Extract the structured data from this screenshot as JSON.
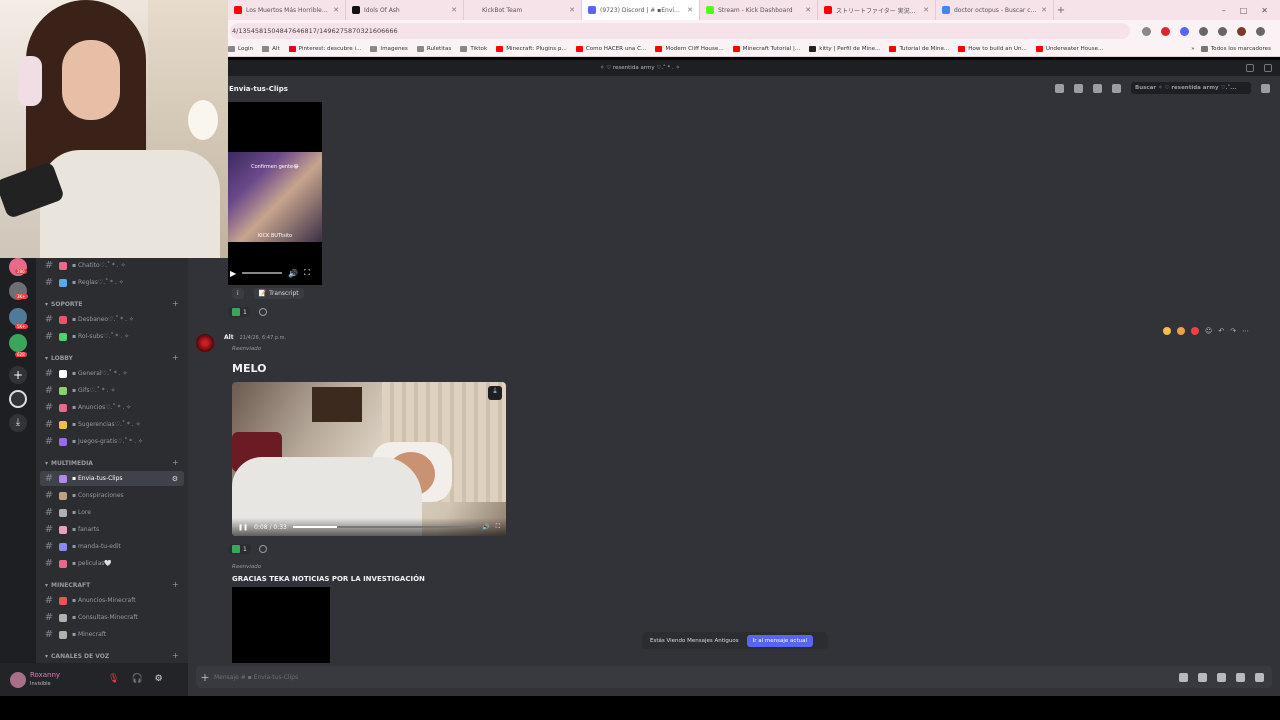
{
  "browser": {
    "tabs": [
      {
        "label": "Los Muertos Más Horribles De...",
        "color": "#ff0000"
      },
      {
        "label": "Idols Of Ash",
        "color": "#111111"
      },
      {
        "label": "KickBot Team",
        "color": "#f6e3ea"
      },
      {
        "label": "(9723) Discord | # ▪Enví...",
        "color": "#5865f2"
      },
      {
        "label": "Stream - Kick Dashboard",
        "color": "#53fc18"
      },
      {
        "label": "ストリートファイター 実況動画 \"LV...",
        "color": "#ff0000"
      },
      {
        "label": "doctor octopus - Buscar con G...",
        "color": "#4285f4"
      }
    ],
    "new_tab": "+",
    "window_controls": [
      "–",
      "□",
      "✕"
    ],
    "url": "4/1354581504847646817/1496275870321606666",
    "bookmarks": [
      {
        "label": "Login",
        "color": "#888888"
      },
      {
        "label": "Alt",
        "color": "#888888"
      },
      {
        "label": "Pinterest: descubre i...",
        "color": "#e60023"
      },
      {
        "label": "Imagenes",
        "color": "#888888"
      },
      {
        "label": "Ruletitas",
        "color": "#888888"
      },
      {
        "label": "Tiktok",
        "color": "#888888"
      },
      {
        "label": "Minecraft: Plugins p...",
        "color": "#ff0000"
      },
      {
        "label": "Como HACER una C...",
        "color": "#ff0000"
      },
      {
        "label": "Modern Cliff House...",
        "color": "#ff0000"
      },
      {
        "label": "Minecraft Tutorial |...",
        "color": "#ff0000"
      },
      {
        "label": "kitty | Perfil de Mine...",
        "color": "#222222"
      },
      {
        "label": "Tutorial de Mine...",
        "color": "#ff0000"
      },
      {
        "label": "How to build an Un...",
        "color": "#ff0000"
      },
      {
        "label": "Underwater House...",
        "color": "#ff0000"
      }
    ],
    "bookmarks_more": "»",
    "all_bookmarks": "Todos los marcadores"
  },
  "discord": {
    "server_title": "✧ ♡ resentida army ♡.˚ * . ✧",
    "channel_header": "Envia-tus-Clips",
    "search_placeholder": "Buscar ✧ ♡ resentida army ♡.˚...",
    "server_badges": [
      "286",
      "3K+",
      "5K+",
      "628"
    ],
    "categories": [
      {
        "label": "SOPORTE",
        "plus": "+"
      },
      {
        "label": "LOBBY",
        "plus": "+"
      },
      {
        "label": "MULTIMEDIA",
        "plus": "+"
      },
      {
        "label": "MINECRAFT",
        "plus": "+"
      },
      {
        "label": "CANALES DE VOZ",
        "plus": "+"
      }
    ],
    "channels": {
      "top": [
        {
          "label": "▪ Chatito♡.˚ * . ✧",
          "color": "#e86a8b"
        },
        {
          "label": "▪ Reglas♡.˚ * . ✧",
          "color": "#5fa8e8"
        }
      ],
      "soporte": [
        {
          "label": "▪ Desbaneo♡.˚ * . ✧",
          "color": "#e8556a"
        },
        {
          "label": "▪ Rol-subs♡.˚ * . ✧",
          "color": "#4fd16b"
        }
      ],
      "lobby": [
        {
          "label": "▪ General♡.˚ * . ✧",
          "color": "#ffffff"
        },
        {
          "label": "▪ Gifs♡.˚ * . ✧",
          "color": "#8bd16b"
        },
        {
          "label": "▪ Anuncios♡.˚ * . ✧",
          "color": "#e86a8b"
        },
        {
          "label": "▪ Sugerencias♡.˚ * . ✧",
          "color": "#f0c04a"
        },
        {
          "label": "▪ Juegos-gratis♡.˚ * . ✧",
          "color": "#9b6ae8"
        }
      ],
      "multimedia": [
        {
          "label": "▪ Envia-tus-Clips",
          "color": "#b08ae8"
        },
        {
          "label": "▪ Conspiraciones",
          "color": "#c0a080"
        },
        {
          "label": "▪ Lore",
          "color": "#b0b0b0"
        },
        {
          "label": "▪ fanarts",
          "color": "#e8a0c0"
        },
        {
          "label": "▪ manda-tu-edit",
          "color": "#8a8ae8"
        },
        {
          "label": "▪ peliculas🤍",
          "color": "#e86a8b"
        }
      ],
      "minecraft": [
        {
          "label": "▪ Anuncios-Minecraft",
          "color": "#e85555"
        },
        {
          "label": "▪ Consultas-Minecraft",
          "color": "#b0b0b0"
        },
        {
          "label": "▪ Minecraft",
          "color": "#b0b0b0"
        }
      ]
    },
    "user": {
      "name": "Roxanny",
      "status": "Invisible"
    },
    "messages": {
      "first_video_overlay": "Confirmen gente😂",
      "first_video_caption": "KICK BUTtsito",
      "transcript_label": "Transcript",
      "reaction_count": "1",
      "author": "Alt",
      "timestamp": "21/4/26, 6:47 p.m.",
      "forwarded_label": "Reenviado",
      "title_1": "MELO",
      "video_time": "0:08 / 0:33",
      "video_progress": 0.24,
      "reaction_count_2": "1",
      "forwarded_label_2": "Reenviado",
      "title_2": "GRACIAS TEKA NOTICIAS POR LA INVESTIGACIÓN"
    },
    "older_messages_notice": "Estás Viendo Mensajes Antiguos",
    "jump_button": "Ir al mensaje actual",
    "composer_placeholder": "Mensaje # ▪ Envia-tus-Clips"
  }
}
